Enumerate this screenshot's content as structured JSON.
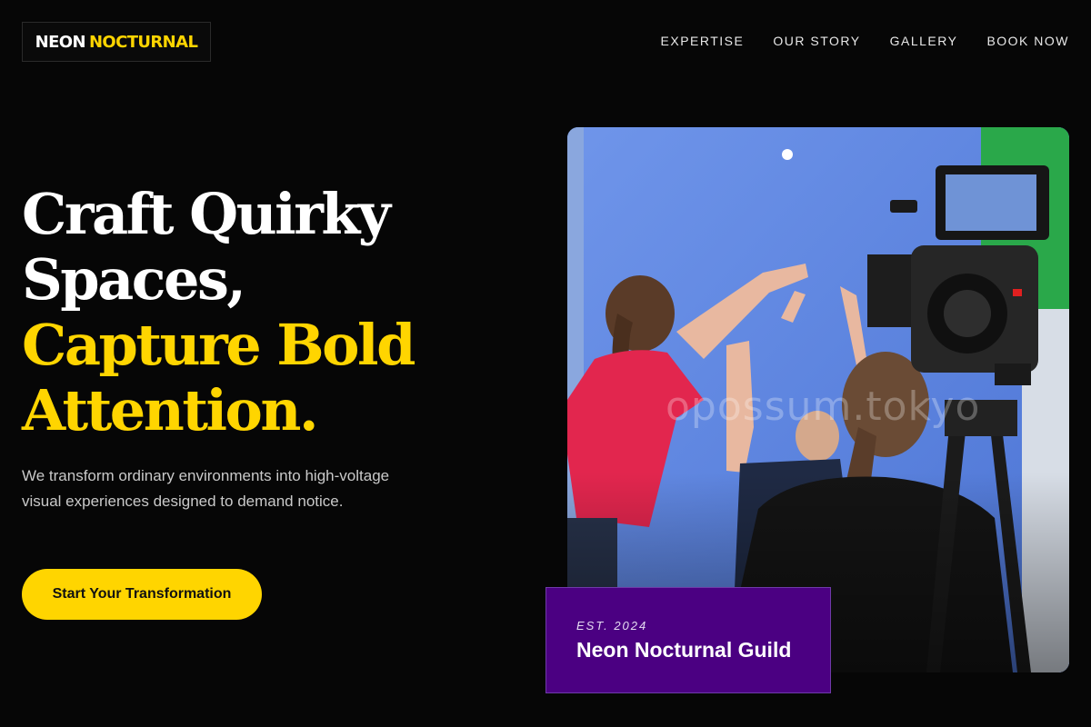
{
  "brand": {
    "name_part1": "NEON",
    "name_part2": "NOCTURNAL"
  },
  "nav": {
    "items": [
      "EXPERTISE",
      "OUR STORY",
      "GALLERY",
      "BOOK NOW"
    ]
  },
  "hero": {
    "headline_white_1": "Craft Quirky",
    "headline_white_2": "Spaces,",
    "headline_yellow_1": "Capture Bold",
    "headline_yellow_2": "Attention.",
    "subtitle": "We transform ordinary environments into high-voltage visual experiences designed to demand notice.",
    "cta_label": "Start Your Transformation"
  },
  "photo": {
    "watermark": "opossum.tokyo"
  },
  "badge": {
    "established": "EST. 2024",
    "name": "Neon Nocturnal Guild"
  },
  "colors": {
    "background": "#060606",
    "accent_yellow": "#ffd500",
    "badge_purple": "#4b0082",
    "text_white": "#ffffff",
    "text_muted": "#c9c9c9"
  },
  "icons": []
}
